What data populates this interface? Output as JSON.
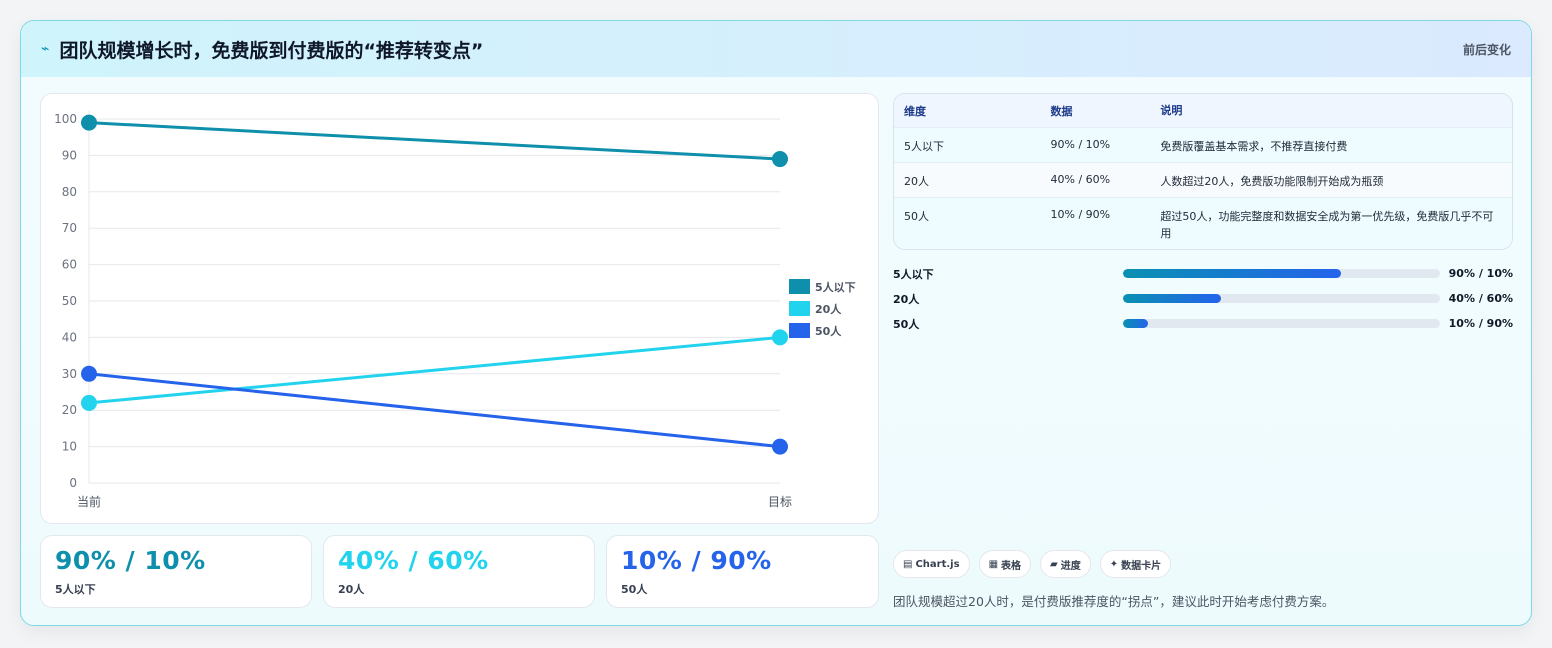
{
  "header": {
    "title": "团队规模增长时，免费版到付费版的“推荐转变点”",
    "right": "前后变化"
  },
  "chart_data": {
    "type": "line",
    "x": [
      "当前",
      "目标"
    ],
    "series": [
      {
        "name": "5人以下",
        "values": [
          99,
          89
        ],
        "color": "#0e8fab"
      },
      {
        "name": "20人",
        "values": [
          22,
          40
        ],
        "color": "#22d3ee"
      },
      {
        "name": "50人",
        "values": [
          30,
          10
        ],
        "color": "#2563eb"
      }
    ],
    "ylim": [
      0,
      100
    ],
    "yticks": [
      0,
      10,
      20,
      30,
      40,
      50,
      60,
      70,
      80,
      90,
      100
    ],
    "grid": true,
    "legend": "right"
  },
  "kpis": [
    {
      "value": "90% / 10%",
      "label": "5人以下",
      "color": "#0e8fab"
    },
    {
      "value": "40% / 60%",
      "label": "20人",
      "color": "#22d3ee"
    },
    {
      "value": "10% / 90%",
      "label": "50人",
      "color": "#2563eb"
    }
  ],
  "table": {
    "headers": [
      "维度",
      "数据",
      "说明"
    ],
    "rows": [
      [
        "5人以下",
        "90% / 10%",
        "免费版覆盖基本需求，不推荐直接付费"
      ],
      [
        "20人",
        "40% / 60%",
        "人数超过20人，免费版功能限制开始成为瓶颈"
      ],
      [
        "50人",
        "10% / 90%",
        "超过50人，功能完整度和数据安全成为第一优先级，免费版几乎不可用"
      ]
    ]
  },
  "progress": [
    {
      "name": "5人以下",
      "value": "90% / 10%",
      "fill": 0.69
    },
    {
      "name": "20人",
      "value": "40% / 60%",
      "fill": 0.31
    },
    {
      "name": "50人",
      "value": "10% / 90%",
      "fill": 0.08
    }
  ],
  "chips": [
    {
      "icon": "▤",
      "label": "Chart.js"
    },
    {
      "icon": "▦",
      "label": "表格"
    },
    {
      "icon": "▰",
      "label": "进度"
    },
    {
      "icon": "✦",
      "label": "数据卡片"
    }
  ],
  "note": "团队规模超过20人时，是付费版推荐度的“拐点”，建议此时开始考虑付费方案。"
}
